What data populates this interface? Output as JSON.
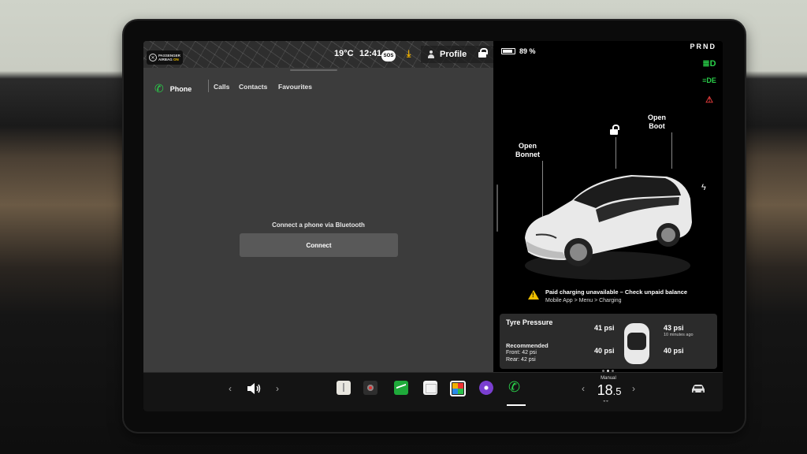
{
  "status_bar": {
    "airbag_line1": "PASSENGER",
    "airbag_line2": "AIRBAG",
    "airbag_state": "ON",
    "temperature": "19°C",
    "time": "12:41",
    "sos": "SOS",
    "profile_label": "Profile"
  },
  "phone": {
    "title": "Phone",
    "tabs": [
      "Calls",
      "Contacts",
      "Favourites"
    ],
    "message": "Connect a phone via Bluetooth",
    "connect_label": "Connect"
  },
  "vehicle": {
    "battery_percent": "89 %",
    "battery_level": 0.89,
    "gear": "PRND",
    "open_bonnet_line1": "Open",
    "open_bonnet_line2": "Bonnet",
    "open_boot_line1": "Open",
    "open_boot_line2": "Boot",
    "warning_title": "Paid charging unavailable – Check unpaid balance",
    "warning_path": "Mobile App > Menu > Charging"
  },
  "tyre_pressure": {
    "title": "Tyre Pressure",
    "recommended_label": "Recommended",
    "front": "Front: 42 psi",
    "rear": "Rear: 42 psi",
    "front_left": "41 psi",
    "front_right": "43 psi",
    "rear_left": "40 psi",
    "rear_right": "40 psi",
    "updated": "10 minutes ago"
  },
  "dock": {
    "climate_mode": "Manual",
    "temp_whole": "18",
    "temp_decimal": ".5"
  },
  "colors": {
    "accent_green": "#2ad04a",
    "warning_yellow": "#f0c000",
    "indicator_red": "#e33b3b"
  },
  "icons": {
    "phone": "phone-icon",
    "volume": "volume-icon",
    "headlights": "headlight-icon",
    "seatbelt": "seatbelt-warning-icon"
  }
}
